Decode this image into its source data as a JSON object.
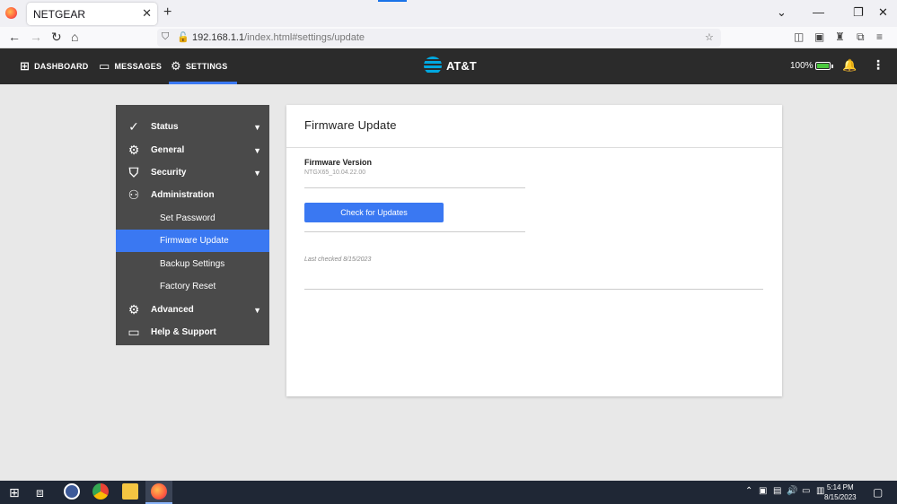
{
  "browser": {
    "tab_title": "NETGEAR",
    "url_host": "192.168.1.1",
    "url_rest": "/index.html#settings/update"
  },
  "header": {
    "nav": [
      {
        "label": "DASHBOARD",
        "icon": "grid-icon"
      },
      {
        "label": "MESSAGES",
        "icon": "message-icon"
      },
      {
        "label": "SETTINGS",
        "icon": "gear-icon"
      }
    ],
    "brand": "AT&T",
    "battery": "100%",
    "battery_level_percent": 100,
    "accent_color": "#3a78f2"
  },
  "sidebar": {
    "items": [
      {
        "label": "Status"
      },
      {
        "label": "General"
      },
      {
        "label": "Security"
      },
      {
        "label": "Administration"
      },
      {
        "label": "Set Password"
      },
      {
        "label": "Firmware Update"
      },
      {
        "label": "Backup Settings"
      },
      {
        "label": "Factory Reset"
      },
      {
        "label": "Advanced"
      },
      {
        "label": "Help & Support"
      }
    ]
  },
  "main": {
    "title": "Firmware Update",
    "firmware_label": "Firmware Version",
    "firmware_value": "NTGX65_10.04.22.00",
    "check_button": "Check for Updates",
    "last_checked": "Last checked 8/15/2023"
  },
  "taskbar": {
    "time": "5:14 PM",
    "date": "8/15/2023"
  }
}
